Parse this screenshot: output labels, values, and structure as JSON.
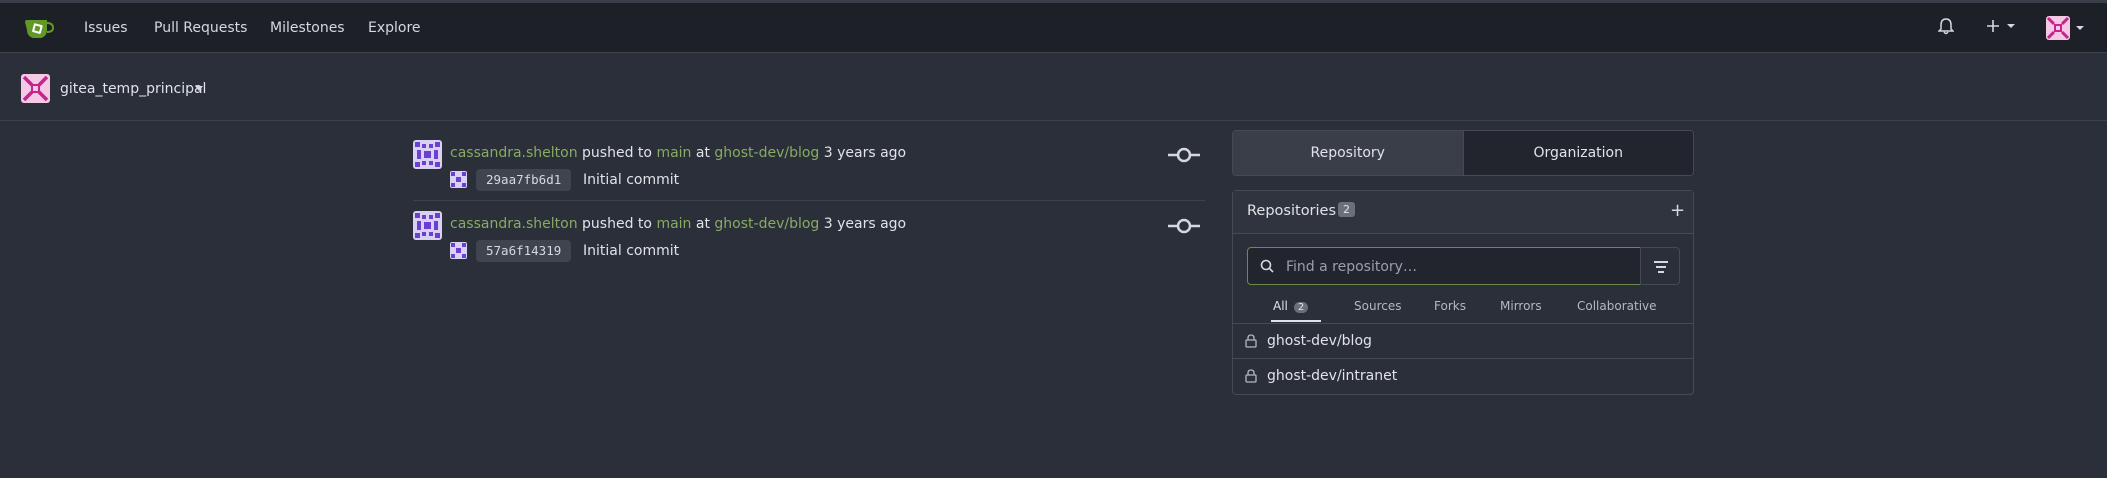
{
  "nav": {
    "items": [
      "Issues",
      "Pull Requests",
      "Milestones",
      "Explore"
    ],
    "right_icons": [
      "bell-icon",
      "plus-icon",
      "avatar"
    ]
  },
  "context": {
    "username": "gitea_temp_principal"
  },
  "feed": [
    {
      "user": "cassandra.shelton",
      "action": "pushed to",
      "branch": "main",
      "at": "at",
      "repo": "ghost-dev/blog",
      "time": "3 years ago",
      "sha": "29aa7fb6d1",
      "message": "Initial commit"
    },
    {
      "user": "cassandra.shelton",
      "action": "pushed to",
      "branch": "main",
      "at": "at",
      "repo": "ghost-dev/blog",
      "time": "3 years ago",
      "sha": "57a6f14319",
      "message": "Initial commit"
    }
  ],
  "sidebar": {
    "tabs": [
      "Repository",
      "Organization"
    ],
    "repos_title": "Repositories",
    "repos_count": "2",
    "search_placeholder": "Find a repository…",
    "filters": [
      {
        "label": "All",
        "count": "2"
      },
      {
        "label": "Sources"
      },
      {
        "label": "Forks"
      },
      {
        "label": "Mirrors"
      },
      {
        "label": "Collaborative"
      }
    ],
    "repos": [
      "ghost-dev/blog",
      "ghost-dev/intranet"
    ]
  },
  "colors": {
    "accent_green": "#87ab63",
    "background": "#2b2f3a",
    "navbar": "#1d2027"
  }
}
